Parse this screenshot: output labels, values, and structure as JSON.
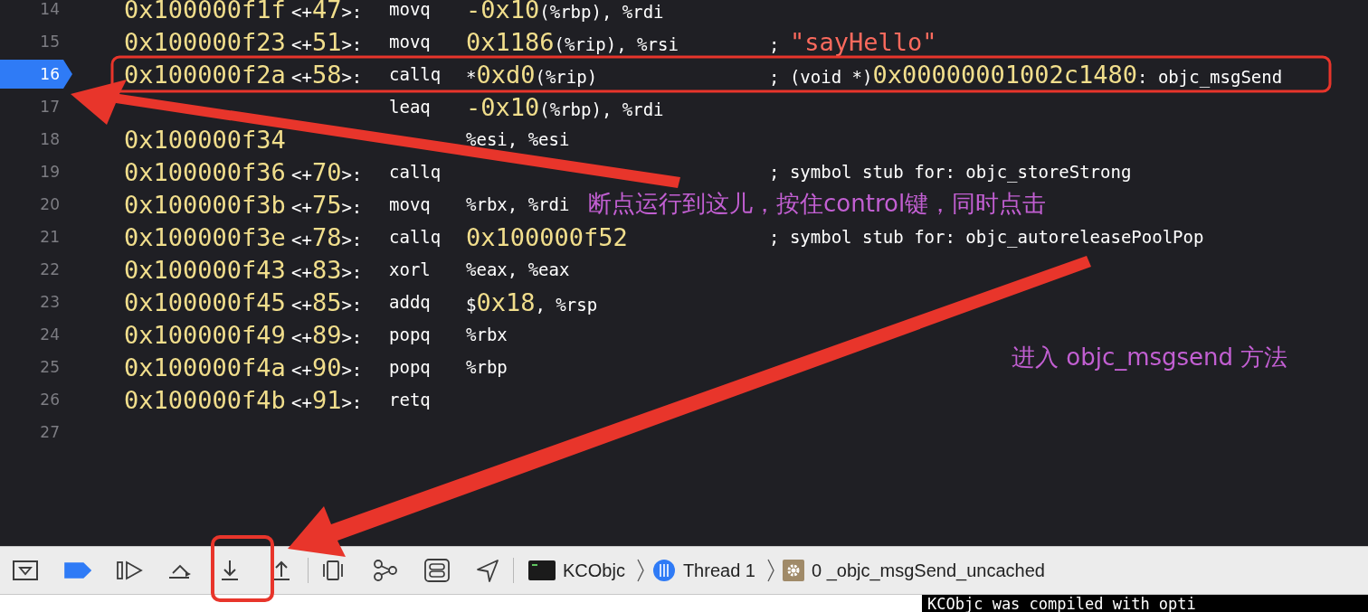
{
  "lines": [
    {
      "number": "14",
      "current": false,
      "address": "0x100000f1f",
      "offset": [
        {
          "text": "<+",
          "kind": "plain"
        },
        {
          "text": "47",
          "kind": "number"
        },
        {
          "text": ">:",
          "kind": "plain"
        }
      ],
      "mnemonic": "movq",
      "operands": [
        {
          "text": "-0x10",
          "kind": "number"
        },
        {
          "text": "(%rbp), %rdi",
          "kind": "plain"
        }
      ]
    },
    {
      "number": "15",
      "current": false,
      "address": "0x100000f23",
      "offset": [
        {
          "text": "<+",
          "kind": "plain"
        },
        {
          "text": "51",
          "kind": "number"
        },
        {
          "text": ">:",
          "kind": "plain"
        }
      ],
      "mnemonic": "movq",
      "operands": [
        {
          "text": "0x1186",
          "kind": "number"
        },
        {
          "text": "(%rip), %rsi",
          "kind": "plain"
        }
      ],
      "comment": [
        {
          "text": "; ",
          "kind": "plain"
        },
        {
          "text": "\"sayHello\"",
          "kind": "string"
        }
      ]
    },
    {
      "number": "16",
      "current": true,
      "address": "0x100000f2a",
      "offset": [
        {
          "text": "<+",
          "kind": "plain"
        },
        {
          "text": "58",
          "kind": "number"
        },
        {
          "text": ">:",
          "kind": "plain"
        }
      ],
      "mnemonic": "callq",
      "operands": [
        {
          "text": "*",
          "kind": "plain"
        },
        {
          "text": "0xd0",
          "kind": "number"
        },
        {
          "text": "(%rip)",
          "kind": "plain"
        }
      ],
      "comment": [
        {
          "text": "; (void *)",
          "kind": "plain"
        },
        {
          "text": "0x00000001002c1480",
          "kind": "number"
        },
        {
          "text": ": objc_msgSend",
          "kind": "plain"
        }
      ]
    },
    {
      "number": "17",
      "current": false,
      "mnemonic": "leaq",
      "operands": [
        {
          "text": "-0x10",
          "kind": "number"
        },
        {
          "text": "(%rbp), %rdi",
          "kind": "plain"
        }
      ]
    },
    {
      "number": "18",
      "current": false,
      "address": "0x100000f34",
      "operands": [
        {
          "text": "%esi, %esi",
          "kind": "plain"
        }
      ]
    },
    {
      "number": "19",
      "current": false,
      "address": "0x100000f36",
      "offset": [
        {
          "text": "<+",
          "kind": "plain"
        },
        {
          "text": "70",
          "kind": "number"
        },
        {
          "text": ">:",
          "kind": "plain"
        }
      ],
      "mnemonic": "callq",
      "comment": [
        {
          "text": "; symbol stub for: objc_storeStrong",
          "kind": "plain"
        }
      ]
    },
    {
      "number": "20",
      "current": false,
      "address": "0x100000f3b",
      "offset": [
        {
          "text": "<+",
          "kind": "plain"
        },
        {
          "text": "75",
          "kind": "number"
        },
        {
          "text": ">:",
          "kind": "plain"
        }
      ],
      "mnemonic": "movq",
      "operands": [
        {
          "text": "%rbx, %rdi",
          "kind": "plain"
        }
      ]
    },
    {
      "number": "21",
      "current": false,
      "address": "0x100000f3e",
      "offset": [
        {
          "text": "<+",
          "kind": "plain"
        },
        {
          "text": "78",
          "kind": "number"
        },
        {
          "text": ">:",
          "kind": "plain"
        }
      ],
      "mnemonic": "callq",
      "operands": [
        {
          "text": "0x100000f52",
          "kind": "number"
        }
      ],
      "comment": [
        {
          "text": "; symbol stub for: objc_autoreleasePoolPop",
          "kind": "plain"
        }
      ]
    },
    {
      "number": "22",
      "current": false,
      "address": "0x100000f43",
      "offset": [
        {
          "text": "<+",
          "kind": "plain"
        },
        {
          "text": "83",
          "kind": "number"
        },
        {
          "text": ">:",
          "kind": "plain"
        }
      ],
      "mnemonic": "xorl",
      "operands": [
        {
          "text": "%eax, %eax",
          "kind": "plain"
        }
      ]
    },
    {
      "number": "23",
      "current": false,
      "address": "0x100000f45",
      "offset": [
        {
          "text": "<+",
          "kind": "plain"
        },
        {
          "text": "85",
          "kind": "number"
        },
        {
          "text": ">:",
          "kind": "plain"
        }
      ],
      "mnemonic": "addq",
      "operands": [
        {
          "text": "$",
          "kind": "plain"
        },
        {
          "text": "0x18",
          "kind": "number"
        },
        {
          "text": ", %rsp",
          "kind": "plain"
        }
      ]
    },
    {
      "number": "24",
      "current": false,
      "address": "0x100000f49",
      "offset": [
        {
          "text": "<+",
          "kind": "plain"
        },
        {
          "text": "89",
          "kind": "number"
        },
        {
          "text": ">:",
          "kind": "plain"
        }
      ],
      "mnemonic": "popq",
      "operands": [
        {
          "text": "%rbx",
          "kind": "plain"
        }
      ]
    },
    {
      "number": "25",
      "current": false,
      "address": "0x100000f4a",
      "offset": [
        {
          "text": "<+",
          "kind": "plain"
        },
        {
          "text": "90",
          "kind": "number"
        },
        {
          "text": ">:",
          "kind": "plain"
        }
      ],
      "mnemonic": "popq",
      "operands": [
        {
          "text": "%rbp",
          "kind": "plain"
        }
      ]
    },
    {
      "number": "26",
      "current": false,
      "address": "0x100000f4b",
      "offset": [
        {
          "text": "<+",
          "kind": "plain"
        },
        {
          "text": "91",
          "kind": "number"
        },
        {
          "text": ">:",
          "kind": "plain"
        }
      ],
      "mnemonic": "retq"
    },
    {
      "number": "27",
      "current": false
    }
  ],
  "notes": [
    {
      "text": "断点运行到这儿，按住control键，同时点击"
    },
    {
      "text": "进入 objc_msgsend 方法"
    }
  ],
  "toolbar": {
    "buttons": [
      {
        "kind": "debug-area"
      },
      {
        "kind": "breakpoints",
        "on": true
      },
      {
        "kind": "continue"
      },
      {
        "kind": "step-over"
      },
      {
        "kind": "step-into"
      },
      {
        "kind": "step-out"
      },
      {
        "kind": "divider"
      },
      {
        "kind": "view-hierarchy"
      },
      {
        "kind": "memory-graph"
      },
      {
        "kind": "environment"
      },
      {
        "kind": "location"
      },
      {
        "kind": "divider"
      }
    ],
    "breadcrumbs": [
      {
        "kind": "app",
        "label": "KCObjc"
      },
      {
        "kind": "thread",
        "label": "Thread 1"
      },
      {
        "kind": "frame",
        "label": "0 _objc_msgSend_uncached"
      }
    ]
  },
  "console": {
    "text": "KCObjc was compiled with opti"
  }
}
